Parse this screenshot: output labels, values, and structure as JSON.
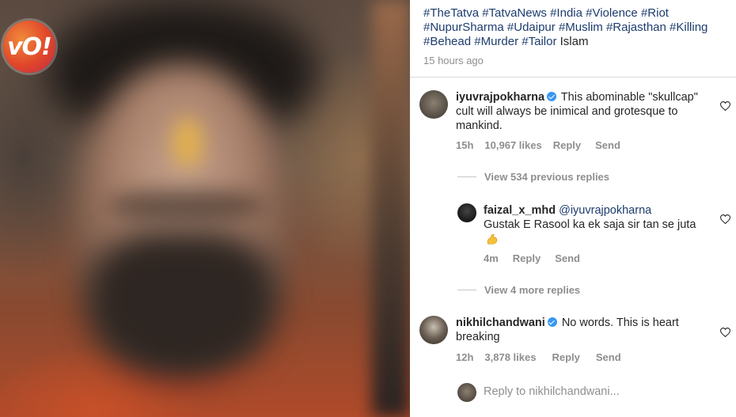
{
  "logo": {
    "text": "vO!"
  },
  "caption": {
    "hashtags": [
      "#TheTatva",
      "#TatvaNews",
      "#India",
      "#Violence",
      "#Riot",
      "#NupurSharma",
      "#Udaipur",
      "#Muslim",
      "#Rajasthan",
      "#Killing",
      "#Behead",
      "#Murder",
      "#Tailor"
    ],
    "trailing_text": "Islam",
    "time_ago": "15 hours ago"
  },
  "comments": [
    {
      "username": "iyuvrajpokharna",
      "verified": true,
      "text": "This abominable \"skullcap\" cult will always be inimical and grotesque to mankind.",
      "time": "15h",
      "likes": "10,967 likes",
      "reply_label": "Reply",
      "send_label": "Send"
    }
  ],
  "view_previous_replies": "View 534 previous replies",
  "reply": {
    "username": "faizal_x_mhd",
    "mention": "@iyuvrajpokharna",
    "text": "Gustak E Rasool ka ek saja sir tan se juta",
    "time": "4m",
    "reply_label": "Reply",
    "send_label": "Send"
  },
  "view_more_replies": "View 4 more replies",
  "comment2": {
    "username": "nikhilchandwani",
    "verified": true,
    "text": "No words. This is heart breaking",
    "time": "12h",
    "likes": "3,878 likes",
    "reply_label": "Reply",
    "send_label": "Send"
  },
  "reply_to_placeholder": "Reply to nikhilchandwani...",
  "colors": {
    "link": "#1d3c6e",
    "muted": "#8e8e8e",
    "verified": "#3897f0",
    "divider": "#dbdbdb"
  }
}
